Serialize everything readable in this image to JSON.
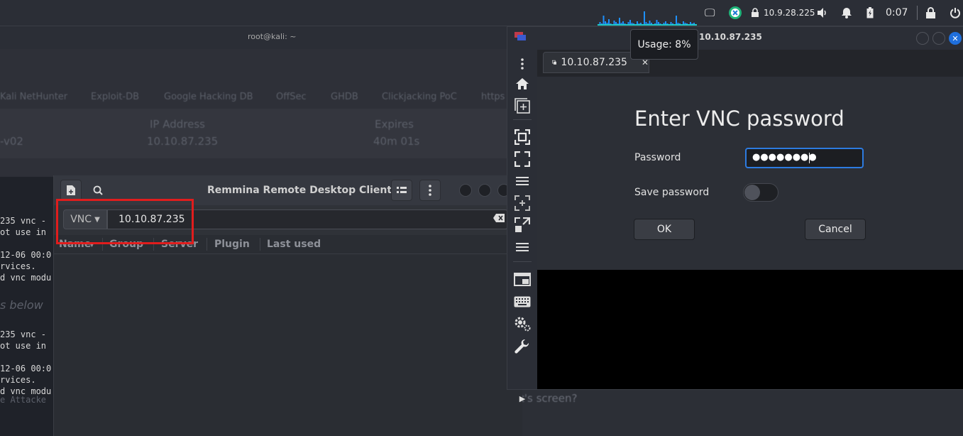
{
  "topbar": {
    "ip": "10.9.28.225",
    "clock": "0:07",
    "tooltip": "Usage: 8%",
    "icons": [
      "cpu-graph-icon",
      "display-icon",
      "vpn-icon",
      "lock-network-icon",
      "volume-icon",
      "bell-icon",
      "battery-icon",
      "lock-icon",
      "power-icon"
    ]
  },
  "terminal": {
    "title": "root@kali: ~",
    "lines": [
      "235 vnc -",
      "ot use in",
      "",
      "12-06 00:0",
      "rvices.",
      "d vnc modu",
      "s below",
      "",
      "235 vnc -",
      "ot use in",
      "",
      "12-06 00:0",
      "rvices.",
      "d vnc modu",
      "e Attacke"
    ]
  },
  "browser": {
    "bookmarks": [
      "Kali NetHunter",
      "Exploit-DB",
      "Google Hacking DB",
      "OffSec",
      "GHDB",
      "Clickjacking PoC",
      "https"
    ],
    "table_headers": [
      "IP Address",
      "Expires"
    ],
    "row": [
      "-v02",
      "10.10.87.235",
      "40m 01s"
    ],
    "bottom_text": "t's screen?"
  },
  "remmina": {
    "title": "Remmina Remote Desktop Client",
    "protocol": "VNC",
    "quick_connect_value": "10.10.87.235",
    "columns": [
      "Name",
      "Group",
      "Server",
      "Plugin",
      "Last used"
    ]
  },
  "connection": {
    "window_title": "10.10.87.235",
    "tab_label": "10.10.87.235",
    "dialog": {
      "title": "Enter VNC password",
      "password_label": "Password",
      "password_mask": "●●●●●●●●",
      "save_label": "Save password",
      "save_enabled": false,
      "ok_label": "OK",
      "cancel_label": "Cancel"
    }
  }
}
